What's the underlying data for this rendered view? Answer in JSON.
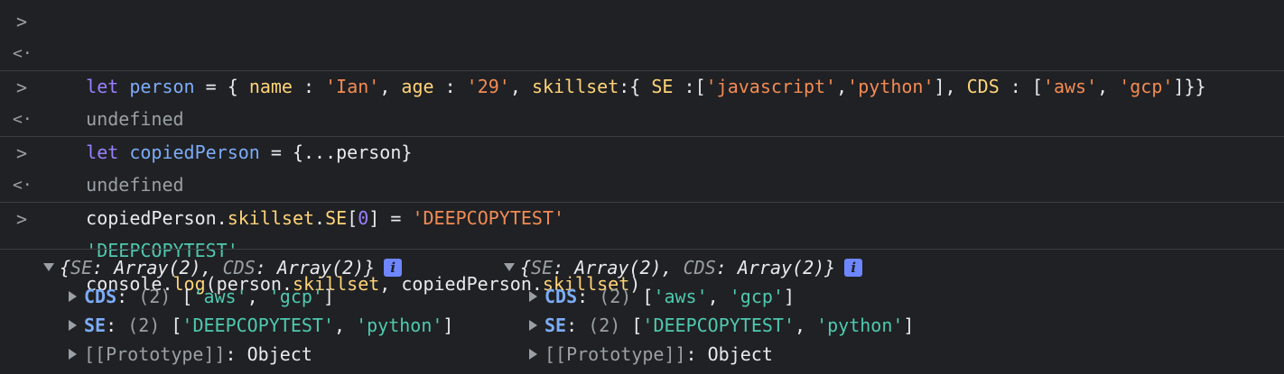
{
  "console": {
    "prompt_glyph": ">",
    "return_glyph": "<·",
    "lines": {
      "l1": {
        "kw": "let",
        "var": "person",
        "eq": " = { ",
        "k_name": "name",
        "c1": " : ",
        "v_name": "'Ian'",
        "c2": ", ",
        "k_age": "age",
        "c3": " : ",
        "v_age": "'29'",
        "c4": ", ",
        "k_skillset": "skillset",
        "c5": ":{ ",
        "k_se": "SE",
        "c6": " :[",
        "v_js": "'javascript'",
        "c7": ",",
        "v_py": "'python'",
        "c8": "], ",
        "k_cds": "CDS",
        "c9": " : [",
        "v_aws": "'aws'",
        "c10": ", ",
        "v_gcp": "'gcp'",
        "c11": "]}}"
      },
      "r1": "undefined",
      "l2": {
        "kw": "let",
        "var": "copiedPerson",
        "rest": " = {...person}"
      },
      "r2": "undefined",
      "l3": {
        "a": "copiedPerson.",
        "b": "skillset",
        "c": ".",
        "d": "SE",
        "e": "[",
        "f": "0",
        "g": "] = ",
        "h": "'DEEPCOPYTEST'"
      },
      "r3": "'DEEPCOPYTEST'",
      "l4": {
        "a": "console.",
        "b": "log",
        "c": "(person.",
        "d": "skillset",
        "e": ", copiedPerson.",
        "f": "skillset",
        "g": ")"
      }
    },
    "objects": [
      {
        "summary": {
          "open": "{",
          "k1": "SE",
          "v1": ": Array(2), ",
          "k2": "CDS",
          "v2": ": Array(2)}",
          "info": "i"
        },
        "cds": {
          "key": "CDS",
          "colon": ": ",
          "count": "(2) ",
          "open": "[",
          "a": "'aws'",
          "sep": ", ",
          "b": "'gcp'",
          "close": "]"
        },
        "se": {
          "key": "SE",
          "colon": ": ",
          "count": "(2) ",
          "open": "[",
          "a": "'DEEPCOPYTEST'",
          "sep": ", ",
          "b": "'python'",
          "close": "]"
        },
        "proto": {
          "key": "[[Prototype]]",
          "colon": ": ",
          "val": "Object"
        }
      },
      {
        "summary": {
          "open": "{",
          "k1": "SE",
          "v1": ": Array(2), ",
          "k2": "CDS",
          "v2": ": Array(2)}",
          "info": "i"
        },
        "cds": {
          "key": "CDS",
          "colon": ": ",
          "count": "(2) ",
          "open": "[",
          "a": "'aws'",
          "sep": ", ",
          "b": "'gcp'",
          "close": "]"
        },
        "se": {
          "key": "SE",
          "colon": ": ",
          "count": "(2) ",
          "open": "[",
          "a": "'DEEPCOPYTEST'",
          "sep": ", ",
          "b": "'python'",
          "close": "]"
        },
        "proto": {
          "key": "[[Prototype]]",
          "colon": ": ",
          "val": "Object"
        }
      }
    ]
  }
}
